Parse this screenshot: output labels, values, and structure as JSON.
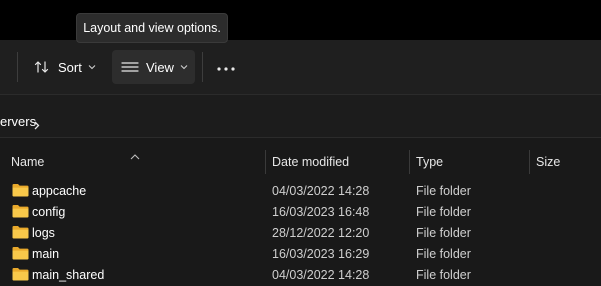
{
  "tooltip": {
    "text": "Layout and view options."
  },
  "toolbar": {
    "sort_label": "Sort",
    "view_label": "View"
  },
  "breadcrumb": {
    "current": "ervers"
  },
  "columns": {
    "name": "Name",
    "date_modified": "Date modified",
    "type": "Type",
    "size": "Size"
  },
  "files": [
    {
      "name": "appcache",
      "date": "04/03/2022 14:28",
      "type": "File folder",
      "icon": "folder-icon"
    },
    {
      "name": "config",
      "date": "16/03/2023 16:48",
      "type": "File folder",
      "icon": "folder-icon"
    },
    {
      "name": "logs",
      "date": "28/12/2022 12:20",
      "type": "File folder",
      "icon": "folder-icon"
    },
    {
      "name": "main",
      "date": "16/03/2023 16:29",
      "type": "File folder",
      "icon": "folder-icon"
    },
    {
      "name": "main_shared",
      "date": "04/03/2022 14:28",
      "type": "File folder",
      "icon": "folder-icon"
    }
  ],
  "colors": {
    "background": "#191919",
    "toolbar": "#1f1f1f",
    "folder": "#f5c242"
  }
}
